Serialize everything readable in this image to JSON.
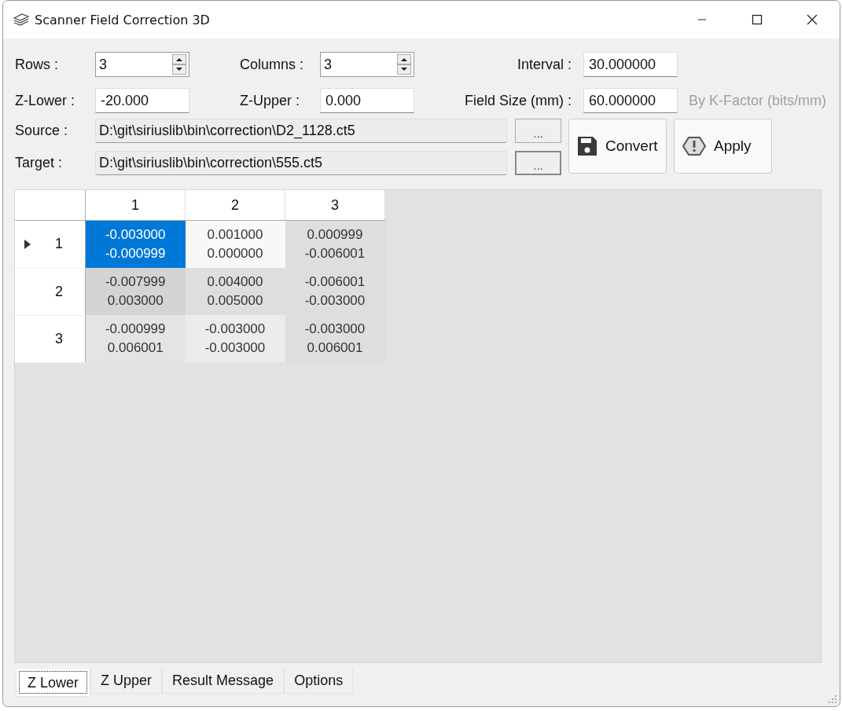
{
  "window": {
    "title": "Scanner Field Correction 3D"
  },
  "form": {
    "rows": {
      "label": "Rows :",
      "value": "3"
    },
    "columns": {
      "label": "Columns :",
      "value": "3"
    },
    "interval": {
      "label": "Interval :",
      "value": "30.000000"
    },
    "z_lower": {
      "label": "Z-Lower :",
      "value": "-20.000"
    },
    "z_upper": {
      "label": "Z-Upper :",
      "value": "0.000"
    },
    "field_size": {
      "label": "Field Size (mm) :",
      "value": "60.000000"
    },
    "k_factor": {
      "label": "By K-Factor (bits/mm)",
      "disabled": true
    },
    "source": {
      "label": "Source :",
      "value": "D:\\git\\siriuslib\\bin\\correction\\D2_1128.ct5",
      "browse": "...",
      "focused": false
    },
    "target": {
      "label": "Target :",
      "value": "D:\\git\\siriuslib\\bin\\correction\\555.ct5",
      "browse": "...",
      "focused": true
    }
  },
  "buttons": [
    {
      "label": "Convert"
    },
    {
      "label": "Apply"
    }
  ],
  "table": {
    "columns": [
      "1",
      "2",
      "3"
    ],
    "rows": [
      {
        "header": "1",
        "current": true,
        "cells": [
          {
            "values": [
              "-0.003000",
              "-0.000999"
            ],
            "selected": true,
            "color": "#0078d7"
          },
          {
            "values": [
              "0.001000",
              "0.000000"
            ],
            "selected": false,
            "color": "#f8f8f8"
          },
          {
            "values": [
              "0.000999",
              "-0.006001"
            ],
            "selected": false,
            "color": "#dedede"
          }
        ]
      },
      {
        "header": "2",
        "current": false,
        "cells": [
          {
            "values": [
              "-0.007999",
              "0.003000"
            ],
            "selected": false,
            "color": "#d4d4d4"
          },
          {
            "values": [
              "0.004000",
              "0.005000"
            ],
            "selected": false,
            "color": "#dedede"
          },
          {
            "values": [
              "-0.006001",
              "-0.003000"
            ],
            "selected": false,
            "color": "#dedede"
          }
        ]
      },
      {
        "header": "3",
        "current": false,
        "cells": [
          {
            "values": [
              "-0.000999",
              "0.006001"
            ],
            "selected": false,
            "color": "#e4e4e4"
          },
          {
            "values": [
              "-0.003000",
              "-0.003000"
            ],
            "selected": false,
            "color": "#ececec"
          },
          {
            "values": [
              "-0.003000",
              "0.006001"
            ],
            "selected": false,
            "color": "#dedede"
          }
        ]
      }
    ]
  },
  "tabs": [
    {
      "label": "Z Lower",
      "selected": true
    },
    {
      "label": "Z Upper",
      "selected": false
    },
    {
      "label": "Result Message",
      "selected": false
    },
    {
      "label": "Options",
      "selected": false
    }
  ]
}
